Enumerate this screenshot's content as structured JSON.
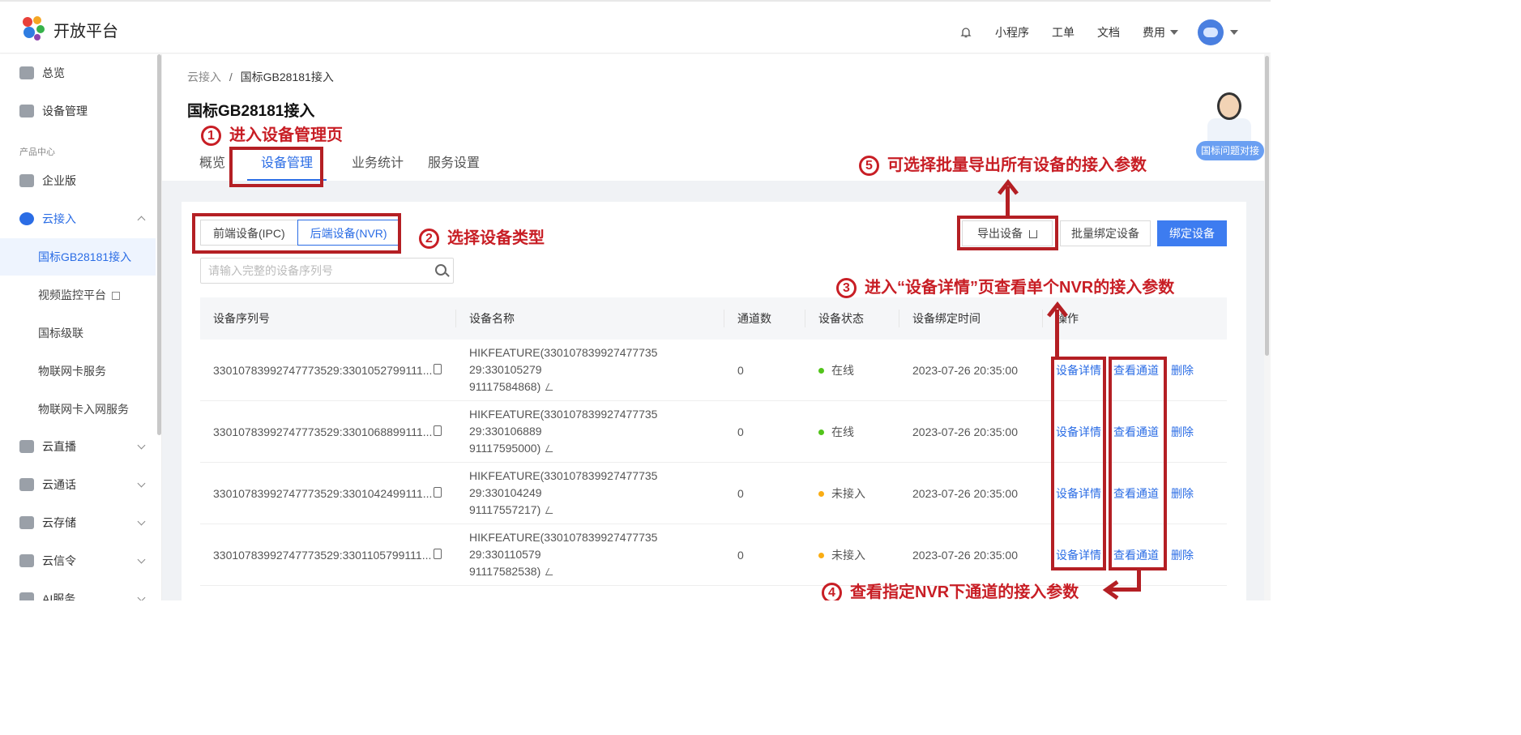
{
  "app": {
    "brand": "开放平台"
  },
  "topnav": {
    "miniapp": "小程序",
    "ticket": "工单",
    "docs": "文档",
    "fee": "费用"
  },
  "sidebar": {
    "overview": "总览",
    "device_mgmt": "设备管理",
    "section_product": "产品中心",
    "enterprise": "企业版",
    "cloud_access": "云接入",
    "gb28181": "国标GB28181接入",
    "video_platform": "视频监控平台",
    "gb_cascade": "国标级联",
    "iot_card": "物联网卡服务",
    "iot_card_access": "物联网卡入网服务",
    "live": "云直播",
    "call": "云通话",
    "storage": "云存储",
    "signal": "云信令",
    "ai": "AI服务"
  },
  "breadcrumb": {
    "root": "云接入",
    "sep": "/",
    "current": "国标GB28181接入"
  },
  "page": {
    "title": "国标GB28181接入",
    "tabs": [
      "概览",
      "设备管理",
      "业务统计",
      "服务设置"
    ]
  },
  "filter": {
    "seg_ipc": "前端设备(IPC)",
    "seg_nvr": "后端设备(NVR)",
    "search_placeholder": "请输入完整的设备序列号"
  },
  "actions": {
    "export": "导出设备",
    "batch_bind": "批量绑定设备",
    "bind": "绑定设备"
  },
  "table": {
    "headers": [
      "设备序列号",
      "设备名称",
      "通道数",
      "设备状态",
      "设备绑定时间",
      "操作"
    ],
    "rows": [
      {
        "serial": "330107839927477735​29:3301052799111...",
        "name1": "HIKFEATURE(330107839927477735​29:330105279",
        "name2": "91117584868)",
        "channels": "0",
        "status": "在线",
        "status_color": "#52c41a",
        "time": "2023-07-26 20:35:00"
      },
      {
        "serial": "330107839927477735​29:3301068899111...",
        "name1": "HIKFEATURE(330107839927477735​29:330106889",
        "name2": "91117595000)",
        "channels": "0",
        "status": "在线",
        "status_color": "#52c41a",
        "time": "2023-07-26 20:35:00"
      },
      {
        "serial": "330107839927477735​29:3301042499111...",
        "name1": "HIKFEATURE(330107839927477735​29:330104249",
        "name2": "91117557217)",
        "channels": "0",
        "status": "未接入",
        "status_color": "#faad14",
        "time": "2023-07-26 20:35:00"
      },
      {
        "serial": "330107839927477735​29:3301105799111...",
        "name1": "HIKFEATURE(330107839927477735​29:330110579",
        "name2": "91117582538)",
        "channels": "0",
        "status": "未接入",
        "status_color": "#faad14",
        "time": "2023-07-26 20:35:00"
      }
    ],
    "op_detail": "设备详情",
    "op_channels": "查看通道",
    "op_delete": "删除"
  },
  "helper": {
    "label": "国标问题对接"
  },
  "annotations": {
    "a1_num": "1",
    "a1": "进入设备管理页",
    "a2_num": "2",
    "a2": "选择设备类型",
    "a3_num": "3",
    "a3": "进入“设备详情”页查看单个NVR的接入参数",
    "a4_num": "4",
    "a4": "查看指定NVR下通道的接入参数",
    "a5_num": "5",
    "a5": "可选择批量导出所有设备的接入参数"
  },
  "colors": {
    "accent": "#2b6de5",
    "annotation": "#c81e25"
  }
}
